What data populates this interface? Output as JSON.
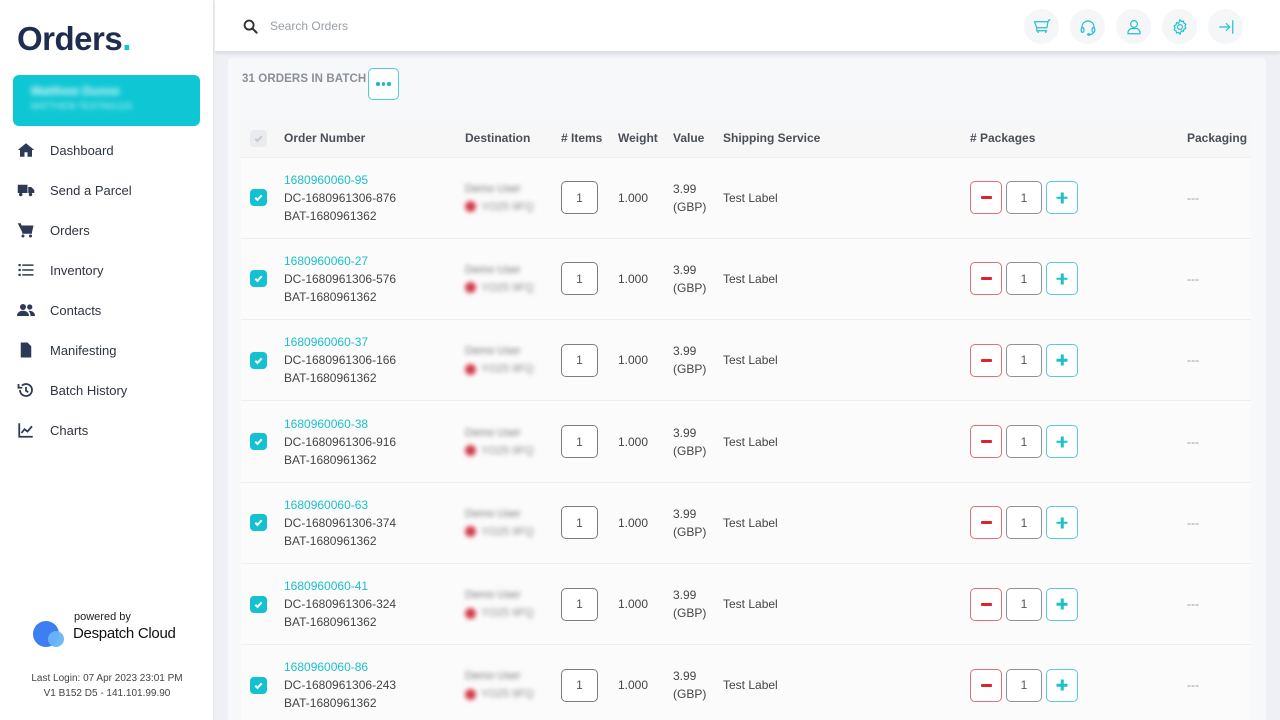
{
  "sidebar": {
    "logo": "Orders",
    "logo_dot": ".",
    "user": {
      "name": "Matthew Dunne",
      "subtitle": "MATTHEW TESTING123"
    },
    "items": [
      {
        "label": "Dashboard",
        "icon": "home-icon"
      },
      {
        "label": "Send a Parcel",
        "icon": "truck-icon"
      },
      {
        "label": "Orders",
        "icon": "cart-icon"
      },
      {
        "label": "Inventory",
        "icon": "list-icon"
      },
      {
        "label": "Contacts",
        "icon": "users-icon"
      },
      {
        "label": "Manifesting",
        "icon": "file-icon"
      },
      {
        "label": "Batch History",
        "icon": "history-icon"
      },
      {
        "label": "Charts",
        "icon": "chart-line-icon"
      }
    ],
    "powered_by": "powered by",
    "brand": "Despatch Cloud",
    "last_login": "Last Login: 07 Apr 2023 23:01 PM",
    "version": "V1 B152 D5 - 141.101.99.90"
  },
  "topbar": {
    "search_placeholder": "Search Orders",
    "icons": [
      "cart-icon",
      "headset-icon",
      "user-icon",
      "gear-icon",
      "logout-icon"
    ]
  },
  "batch": {
    "title": "31 ORDERS IN BATCH",
    "more_label": "..."
  },
  "table": {
    "headers": {
      "order_number": "Order Number",
      "destination": "Destination",
      "items": "# Items",
      "weight": "Weight",
      "value": "Value",
      "shipping_service": "Shipping Service",
      "packages": "# Packages",
      "packaging": "Packaging"
    },
    "rows": [
      {
        "checked": true,
        "order_number": "1680960060-95",
        "dc": "DC-1680961306-876",
        "bat": "BAT-1680961362",
        "dest_name": "Demo User",
        "dest_post": "YO25 9FQ",
        "items": "1",
        "weight": "1.000",
        "value": "3.99",
        "currency": "(GBP)",
        "service": "Test Label",
        "packages": "1",
        "packaging": "---"
      },
      {
        "checked": true,
        "order_number": "1680960060-27",
        "dc": "DC-1680961306-576",
        "bat": "BAT-1680961362",
        "dest_name": "Demo User",
        "dest_post": "YO25 9FQ",
        "items": "1",
        "weight": "1.000",
        "value": "3.99",
        "currency": "(GBP)",
        "service": "Test Label",
        "packages": "1",
        "packaging": "---"
      },
      {
        "checked": true,
        "order_number": "1680960060-37",
        "dc": "DC-1680961306-166",
        "bat": "BAT-1680961362",
        "dest_name": "Demo User",
        "dest_post": "YO25 9FQ",
        "items": "1",
        "weight": "1.000",
        "value": "3.99",
        "currency": "(GBP)",
        "service": "Test Label",
        "packages": "1",
        "packaging": "---"
      },
      {
        "checked": true,
        "order_number": "1680960060-38",
        "dc": "DC-1680961306-916",
        "bat": "BAT-1680961362",
        "dest_name": "Demo User",
        "dest_post": "YO25 9FQ",
        "items": "1",
        "weight": "1.000",
        "value": "3.99",
        "currency": "(GBP)",
        "service": "Test Label",
        "packages": "1",
        "packaging": "---"
      },
      {
        "checked": true,
        "order_number": "1680960060-63",
        "dc": "DC-1680961306-374",
        "bat": "BAT-1680961362",
        "dest_name": "Demo User",
        "dest_post": "YO25 9FQ",
        "items": "1",
        "weight": "1.000",
        "value": "3.99",
        "currency": "(GBP)",
        "service": "Test Label",
        "packages": "1",
        "packaging": "---"
      },
      {
        "checked": true,
        "order_number": "1680960060-41",
        "dc": "DC-1680961306-324",
        "bat": "BAT-1680961362",
        "dest_name": "Demo User",
        "dest_post": "YO25 9FQ",
        "items": "1",
        "weight": "1.000",
        "value": "3.99",
        "currency": "(GBP)",
        "service": "Test Label",
        "packages": "1",
        "packaging": "---"
      },
      {
        "checked": true,
        "order_number": "1680960060-86",
        "dc": "DC-1680961306-243",
        "bat": "BAT-1680961362",
        "dest_name": "Demo User",
        "dest_post": "YO25 9FQ",
        "items": "1",
        "weight": "1.000",
        "value": "3.99",
        "currency": "(GBP)",
        "service": "Test Label",
        "packages": "1",
        "packaging": "---"
      }
    ]
  },
  "colors": {
    "accent": "#13c1d0",
    "logo_text": "#1f2d4e",
    "minus": "#d9252f"
  }
}
